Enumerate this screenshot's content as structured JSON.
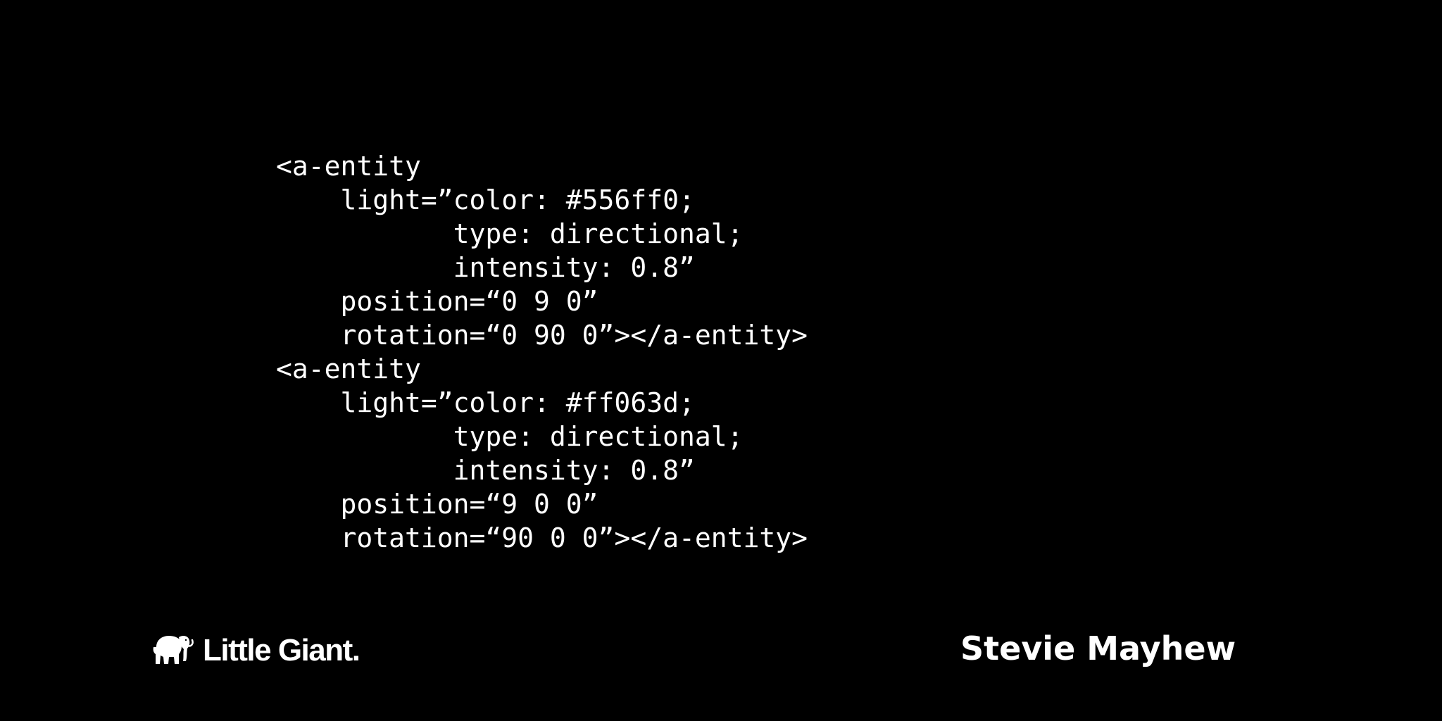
{
  "slide": {
    "code_lines": [
      "<a-entity",
      "    light=”color: #556ff0;",
      "           type: directional;",
      "           intensity: 0.8”",
      "    position=“0 9 0”",
      "    rotation=“0 90 0”></a-entity>",
      "<a-entity",
      "    light=”color: #ff063d;",
      "           type: directional;",
      "           intensity: 0.8”",
      "    position=“9 0 0”",
      "    rotation=“90 0 0”></a-entity>"
    ]
  },
  "footer": {
    "logo_icon": "mammoth-icon",
    "brand": "Little Giant.",
    "speaker": "Stevie Mayhew"
  },
  "colors": {
    "background": "#000000",
    "text": "#ffffff"
  }
}
